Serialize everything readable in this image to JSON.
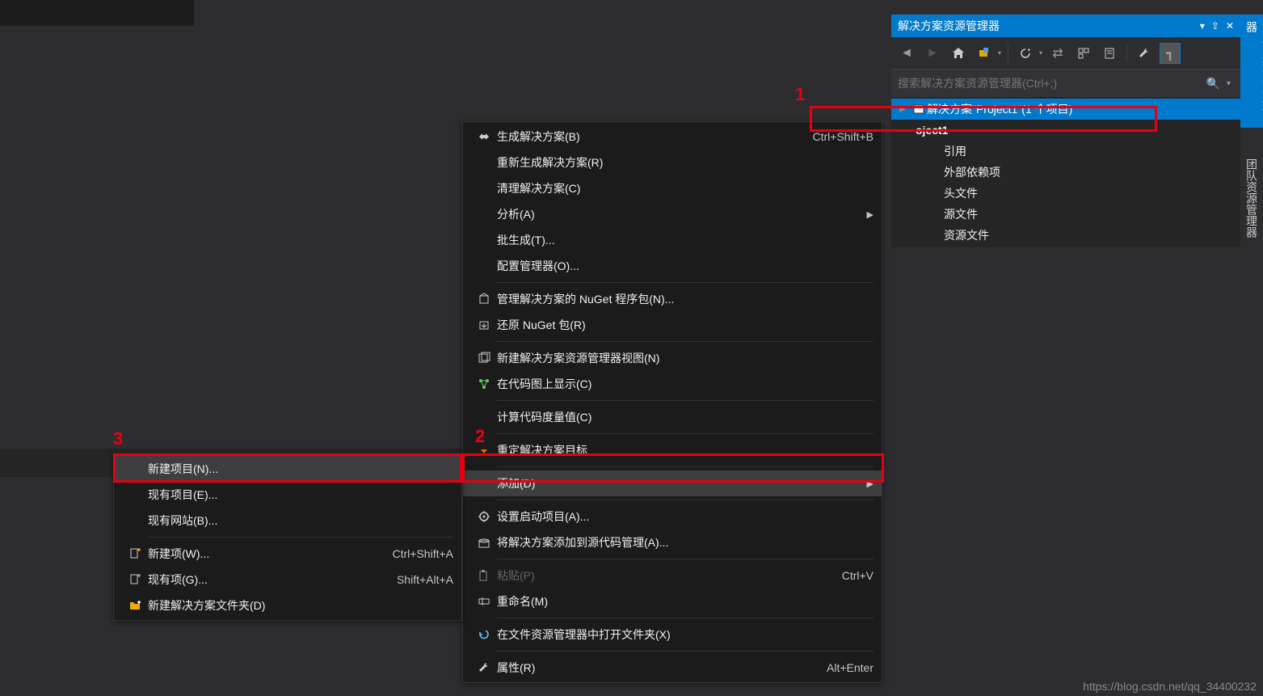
{
  "solution_explorer": {
    "title": "解决方案资源管理器",
    "search_placeholder": "搜索解决方案资源管理器(Ctrl+;)",
    "tree": {
      "solution": "解决方案\"Project1\"(1 个项目)",
      "project": "oject1",
      "children": [
        "引用",
        "外部依赖项",
        "头文件",
        "源文件",
        "资源文件"
      ]
    }
  },
  "vertical_tabs": [
    "解决方案资源管理器",
    "团队资源管理器"
  ],
  "context_menu": {
    "items": [
      {
        "icon": "build-icon",
        "label": "生成解决方案(B)",
        "shortcut": "Ctrl+Shift+B"
      },
      {
        "icon": "",
        "label": "重新生成解决方案(R)",
        "shortcut": ""
      },
      {
        "icon": "",
        "label": "清理解决方案(C)",
        "shortcut": ""
      },
      {
        "icon": "",
        "label": "分析(A)",
        "shortcut": "",
        "arrow": true
      },
      {
        "icon": "",
        "label": "批生成(T)...",
        "shortcut": ""
      },
      {
        "icon": "",
        "label": "配置管理器(O)...",
        "shortcut": ""
      },
      {
        "sep": true
      },
      {
        "icon": "nuget-icon",
        "label": "管理解决方案的 NuGet 程序包(N)...",
        "shortcut": ""
      },
      {
        "icon": "restore-icon",
        "label": "还原 NuGet 包(R)",
        "shortcut": ""
      },
      {
        "sep": true
      },
      {
        "icon": "new-view-icon",
        "label": "新建解决方案资源管理器视图(N)",
        "shortcut": ""
      },
      {
        "icon": "codemap-icon",
        "label": "在代码图上显示(C)",
        "shortcut": ""
      },
      {
        "sep": true
      },
      {
        "icon": "",
        "label": "计算代码度量值(C)",
        "shortcut": ""
      },
      {
        "sep": true
      },
      {
        "icon": "retarget-icon",
        "label": "重定解决方案目标",
        "shortcut": ""
      },
      {
        "sep": true
      },
      {
        "icon": "",
        "label": "添加(D)",
        "shortcut": "",
        "arrow": true,
        "highlighted": true
      },
      {
        "sep": true
      },
      {
        "icon": "startup-icon",
        "label": "设置启动项目(A)...",
        "shortcut": ""
      },
      {
        "icon": "source-icon",
        "label": "将解决方案添加到源代码管理(A)...",
        "shortcut": ""
      },
      {
        "sep": true
      },
      {
        "icon": "paste-icon",
        "label": "粘贴(P)",
        "shortcut": "Ctrl+V",
        "disabled": true
      },
      {
        "icon": "rename-icon",
        "label": "重命名(M)",
        "shortcut": ""
      },
      {
        "sep": true
      },
      {
        "icon": "explorer-icon",
        "label": "在文件资源管理器中打开文件夹(X)",
        "shortcut": ""
      },
      {
        "sep": true
      },
      {
        "icon": "wrench-icon",
        "label": "属性(R)",
        "shortcut": "Alt+Enter"
      }
    ]
  },
  "submenu": {
    "items": [
      {
        "icon": "",
        "label": "新建项目(N)...",
        "shortcut": "",
        "highlighted": true
      },
      {
        "icon": "",
        "label": "现有项目(E)...",
        "shortcut": ""
      },
      {
        "icon": "",
        "label": "现有网站(B)...",
        "shortcut": ""
      },
      {
        "sep": true
      },
      {
        "icon": "new-item-icon",
        "label": "新建项(W)...",
        "shortcut": "Ctrl+Shift+A"
      },
      {
        "icon": "existing-item-icon",
        "label": "现有项(G)...",
        "shortcut": "Shift+Alt+A"
      },
      {
        "icon": "new-folder-icon",
        "label": "新建解决方案文件夹(D)",
        "shortcut": ""
      }
    ]
  },
  "annotations": {
    "one": "1",
    "two": "2",
    "three": "3"
  },
  "watermark": "https://blog.csdn.net/qq_34400232"
}
